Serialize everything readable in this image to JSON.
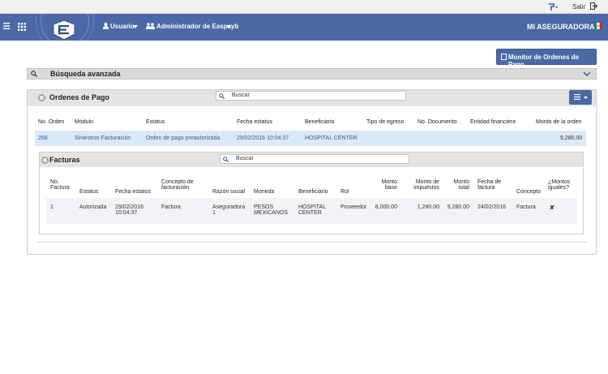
{
  "topbar": {
    "logout_label": "Salir"
  },
  "navbar": {
    "user_label": "Usuario",
    "admin_label": "Administrador de Easpayb",
    "company_label": "MI ASEGURADORA"
  },
  "actions": {
    "monitor_label": "Monitor de Ordenes de Pago"
  },
  "advanced_search": {
    "label": "Búsqueda avanzada"
  },
  "orders": {
    "title": "Ordenes de Pago",
    "search_placeholder": "Buscar",
    "columns": [
      "No. Orden",
      "Módulo",
      "Estatus",
      "Fecha estatus",
      "Beneficiario",
      "Tipo de egreso",
      "No. Documento",
      "Entidad financiera",
      "Monto de la orden"
    ],
    "rows": [
      [
        "268",
        "Siniestros Facturación",
        "Orden de pago preautorizada",
        "29/02/2016 10:04:37",
        "HOSPITAL CENTER",
        "",
        "",
        "",
        "9,280.00"
      ]
    ]
  },
  "invoices": {
    "title": "Facturas",
    "search_placeholder": "Buscar",
    "columns": [
      [
        "No.",
        "Factura"
      ],
      [
        "Estatus"
      ],
      [
        "Fecha estatus"
      ],
      [
        "Concepto de",
        "facturación"
      ],
      [
        "Razón social"
      ],
      [
        "Moneda"
      ],
      [
        "Beneficiario"
      ],
      [
        "Rol"
      ],
      [
        "Monto",
        "base"
      ],
      [
        "Monto de",
        "impuestos"
      ],
      [
        "Monto",
        "total"
      ],
      [
        "Fecha de",
        "factura"
      ],
      [
        "Concepto"
      ],
      [
        "¿Montos",
        "iguales?"
      ]
    ],
    "rows": [
      [
        [
          "1"
        ],
        [
          "Autorizada"
        ],
        [
          "29/02/2016",
          "10:04:37"
        ],
        [
          "Factura"
        ],
        [
          "Aseguradora",
          "1"
        ],
        [
          "PESOS",
          "MEXICANOS"
        ],
        [
          "HOSPITAL",
          "CENTER"
        ],
        [
          "Proveedor"
        ],
        [
          "8,000.00"
        ],
        [
          "1,280.00"
        ],
        [
          "9,280.00"
        ],
        [
          "24/02/2016"
        ],
        [
          "Factura"
        ],
        [
          "✘"
        ]
      ]
    ]
  }
}
